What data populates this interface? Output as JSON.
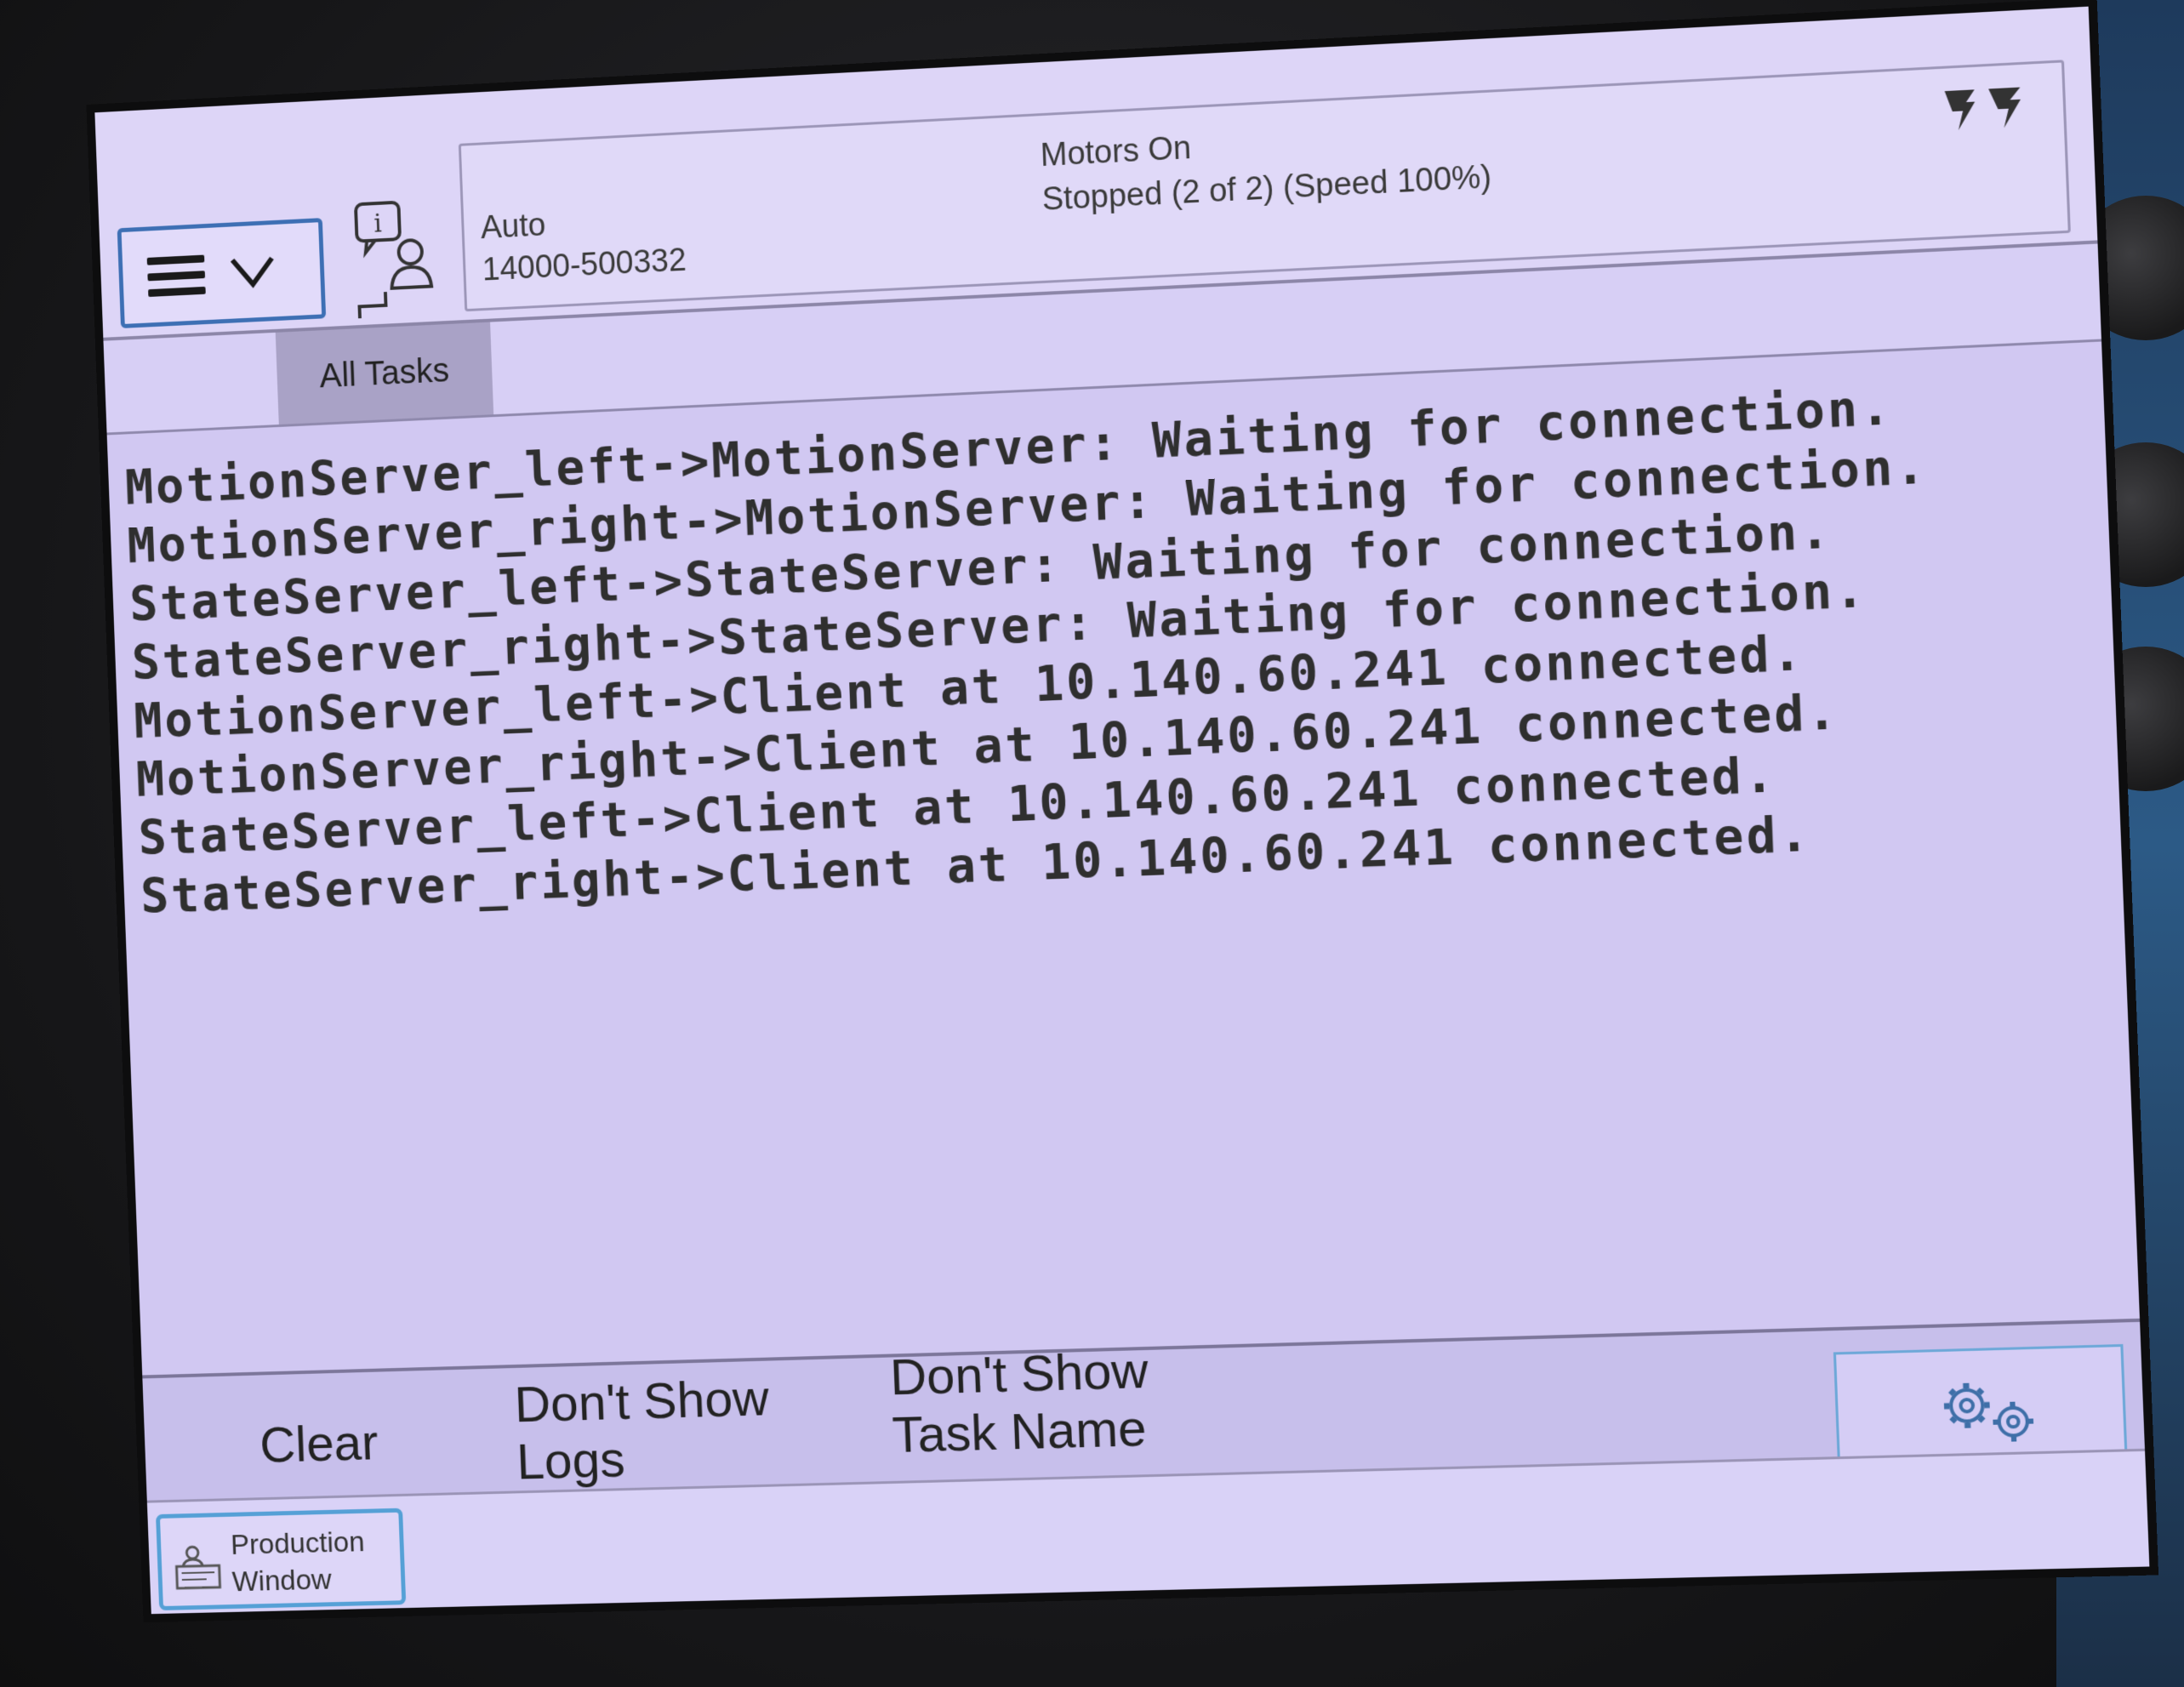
{
  "header": {
    "menu_button": {
      "icon": "hamburger-icon",
      "dropdown_icon": "chevron-down-icon"
    },
    "info_icon": "info-user-icon",
    "status": {
      "mode": "Auto",
      "system_id": "14000-500332",
      "motors": "Motors On",
      "run_state": "Stopped (2 of 2) (Speed 100%)",
      "robot_icon": "robot-arms-icon"
    }
  },
  "tabs": [
    {
      "label": "All Tasks",
      "selected": true
    }
  ],
  "log": {
    "lines": [
      "MotionServer_left->MotionServer: Waiting for connection.",
      "MotionServer_right->MotionServer: Waiting for connection.",
      "StateServer_left->StateServer: Waiting for connection.",
      "StateServer_right->StateServer: Waiting for connection.",
      "MotionServer_left->Client at 10.140.60.241 connected.",
      "MotionServer_right->Client at 10.140.60.241 connected.",
      "StateServer_left->Client at 10.140.60.241 connected.",
      "StateServer_right->Client at 10.140.60.241 connected."
    ]
  },
  "commands": {
    "clear": "Clear",
    "dont_show_logs_line1": "Don't Show",
    "dont_show_logs_line2": "Logs",
    "dont_show_task_line1": "Don't Show",
    "dont_show_task_line2": "Task Name",
    "settings_icon": "gears-icon"
  },
  "taskbar": {
    "production_window_line1": "Production",
    "production_window_line2": "Window",
    "production_icon": "production-window-icon"
  },
  "colors": {
    "screen_bg": "#d4cbf2",
    "button_border": "#3d6fb4",
    "active_border": "#55a0d6",
    "tab_selected": "#a9a2c6"
  }
}
